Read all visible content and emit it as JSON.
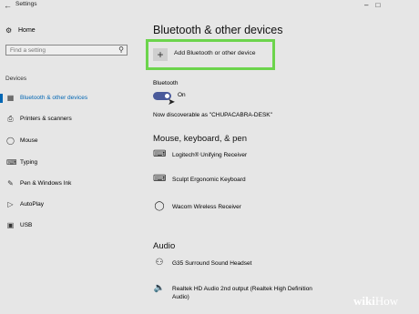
{
  "window": {
    "title": "Settings",
    "back_icon": "back-arrow-icon"
  },
  "sidebar": {
    "home_label": "Home",
    "search_placeholder": "Find a setting",
    "section_label": "Devices",
    "items": [
      {
        "label": "Bluetooth & other devices",
        "icon": "bluetooth-icon",
        "active": true
      },
      {
        "label": "Printers & scanners",
        "icon": "printer-icon"
      },
      {
        "label": "Mouse",
        "icon": "mouse-icon"
      },
      {
        "label": "Typing",
        "icon": "keyboard-icon"
      },
      {
        "label": "Pen & Windows Ink",
        "icon": "pen-icon"
      },
      {
        "label": "AutoPlay",
        "icon": "autoplay-icon"
      },
      {
        "label": "USB",
        "icon": "usb-icon"
      }
    ],
    "accent_color": "#0066b4"
  },
  "main": {
    "title": "Bluetooth & other devices",
    "add_device_label": "Add Bluetooth or other device",
    "bluetooth_label": "Bluetooth",
    "bluetooth_state": "On",
    "discoverable_text": "Now discoverable as \"CHUPACABRA-DESK\"",
    "highlight_color": "#6cd44c",
    "sections": [
      {
        "title": "Mouse, keyboard, & pen",
        "devices": [
          {
            "name": "Logitech® Unifying Receiver",
            "icon": "keyboard-icon"
          },
          {
            "name": "Sculpt Ergonomic Keyboard",
            "icon": "keyboard-icon"
          },
          {
            "name": "Wacom Wireless Receiver",
            "icon": "mouse-icon"
          }
        ]
      },
      {
        "title": "Audio",
        "devices": [
          {
            "name": "G35 Surround Sound Headset",
            "icon": "headset-icon"
          },
          {
            "name": "Realtek HD Audio 2nd output (Realtek High Definition",
            "name2": "Audio)",
            "icon": "speaker-icon"
          }
        ]
      }
    ]
  },
  "watermark": {
    "prefix": "wiki",
    "suffix": "How"
  }
}
